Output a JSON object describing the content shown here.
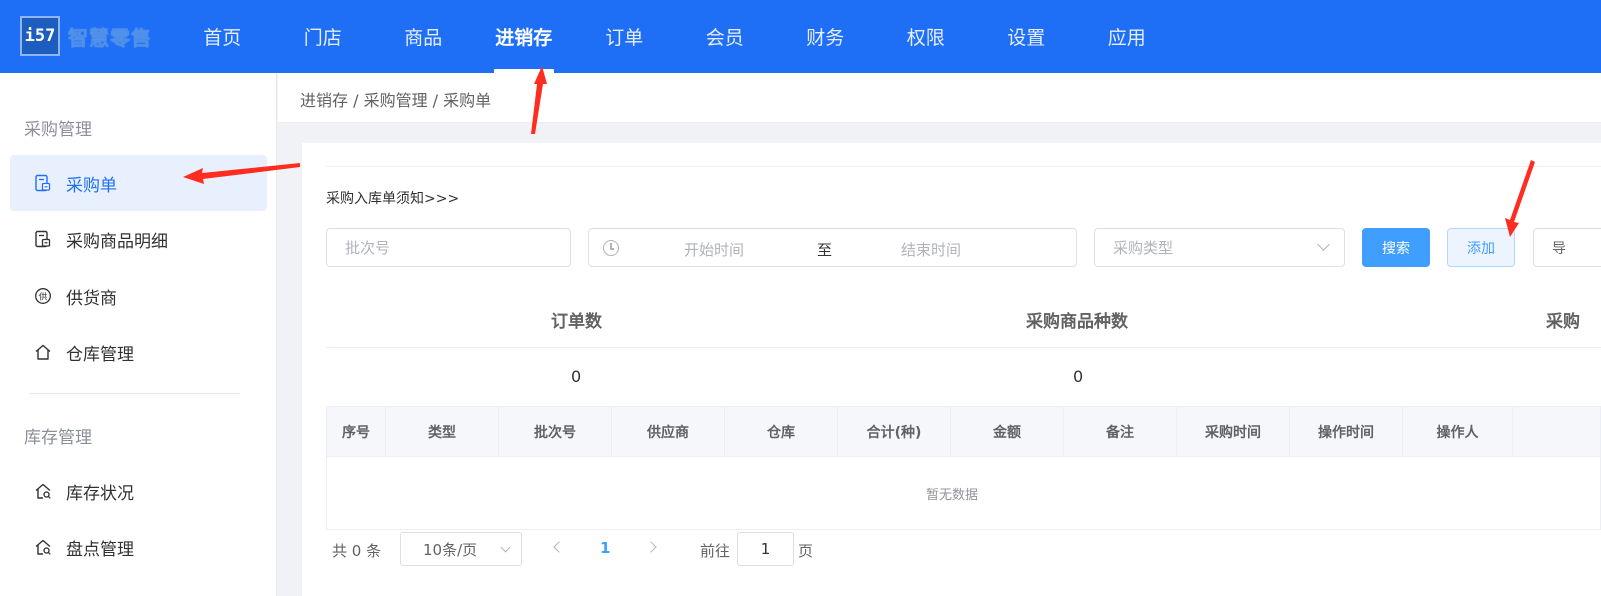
{
  "brand": {
    "logo_mark": "i57",
    "name": "智慧零售"
  },
  "nav": [
    {
      "label": "首页"
    },
    {
      "label": "门店"
    },
    {
      "label": "商品"
    },
    {
      "label": "进销存"
    },
    {
      "label": "订单"
    },
    {
      "label": "会员"
    },
    {
      "label": "财务"
    },
    {
      "label": "权限"
    },
    {
      "label": "设置"
    },
    {
      "label": "应用"
    }
  ],
  "nav_active_index": 3,
  "sidebar": {
    "group1": "采购管理",
    "items1": [
      {
        "label": "采购单",
        "icon": "document-icon",
        "icon_glyph": "⊟"
      },
      {
        "label": "采购商品明细",
        "icon": "document-icon",
        "icon_glyph": "⊟"
      },
      {
        "label": "供货商",
        "icon": "supplier-icon",
        "icon_glyph": "供"
      },
      {
        "label": "仓库管理",
        "icon": "home-icon",
        "icon_glyph": "⌂"
      }
    ],
    "group2": "库存管理",
    "items2": [
      {
        "label": "库存状况",
        "icon": "home-search-icon",
        "icon_glyph": "⌂"
      },
      {
        "label": "盘点管理",
        "icon": "home-search-icon",
        "icon_glyph": "⌂"
      }
    ]
  },
  "breadcrumb": "进销存 / 采购管理 / 采购单",
  "notice": "采购入库单须知>>>",
  "filters": {
    "batch_placeholder": "批次号",
    "date_start": "开始时间",
    "date_sep": "至",
    "date_end": "结束时间",
    "type_placeholder": "采购类型"
  },
  "buttons": {
    "search": "搜索",
    "add": "添加",
    "export": "导"
  },
  "stats": {
    "headers": [
      "订单数",
      "采购商品种数",
      "采购"
    ],
    "values": [
      "0",
      "0"
    ]
  },
  "table": {
    "columns": [
      "序号",
      "类型",
      "批次号",
      "供应商",
      "仓库",
      "合计(种)",
      "金额",
      "备注",
      "采购时间",
      "操作时间",
      "操作人"
    ],
    "empty_text": "暂无数据"
  },
  "pagination": {
    "total": "共 0 条",
    "page_size": "10条/页",
    "current": "1",
    "goto_label": "前往",
    "goto_value": "1",
    "goto_unit": "页"
  },
  "colors": {
    "primary": "#1e6ff5",
    "accent": "#409eff",
    "annotation": "#ff2d1f"
  }
}
